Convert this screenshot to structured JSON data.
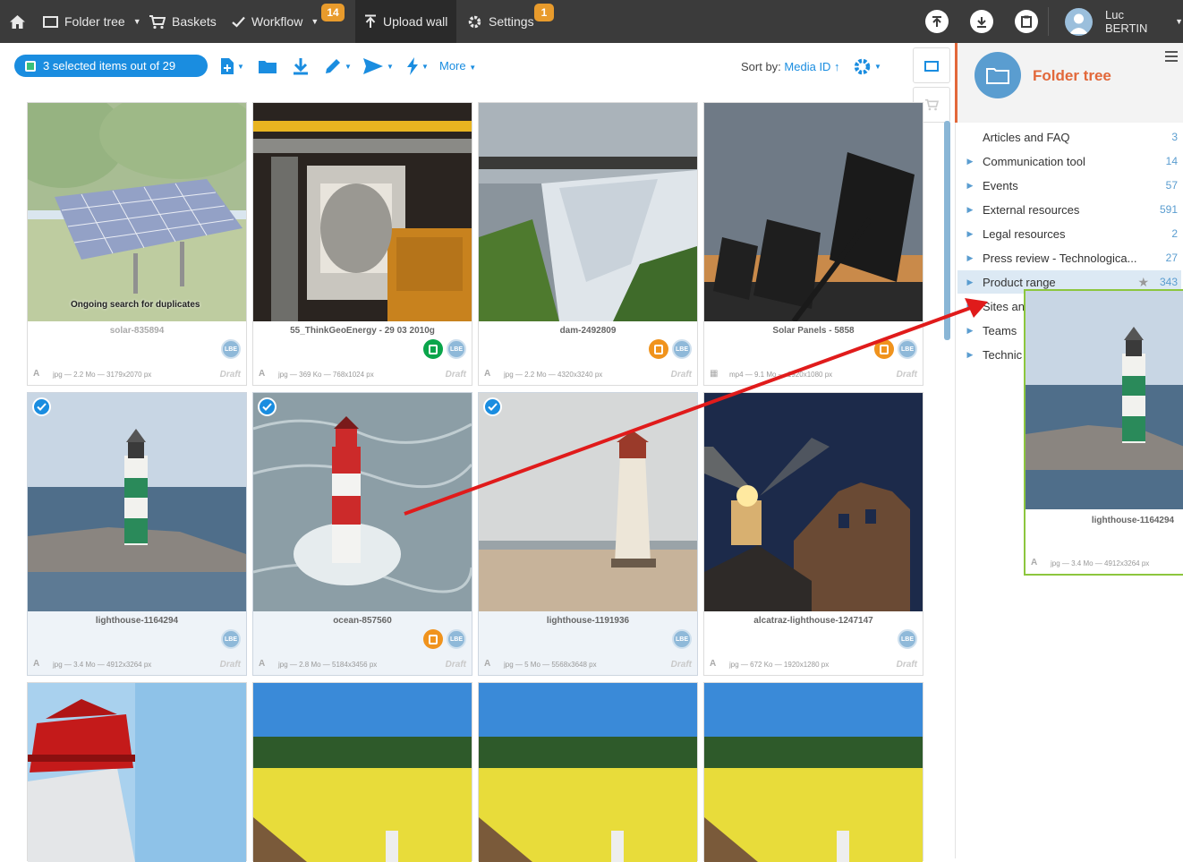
{
  "topnav": {
    "folder_tree": "Folder tree",
    "baskets": "Baskets",
    "workflow": "Workflow",
    "workflow_badge": "14",
    "upload_wall": "Upload wall",
    "settings": "Settings",
    "settings_badge": "1",
    "user_name": "Luc BERTIN"
  },
  "toolbar": {
    "selection_label": "3 selected items out of 29",
    "more_label": "More",
    "sort_prefix": "Sort by:",
    "sort_value": "Media ID ↑"
  },
  "cards": [
    {
      "caption": "solar-835894",
      "meta": "jpg — 2.2 Mo — 3179x2070 px",
      "status": "Draft",
      "overlay": "Ongoing search for duplicates",
      "badge": "LBE",
      "extra_badge": null,
      "selected": false,
      "type_icon": "A"
    },
    {
      "caption": "55_ThinkGeoEnergy - 29 03 2010g",
      "meta": "jpg — 369 Ko — 768x1024 px",
      "status": "Draft",
      "badge": "LBE",
      "extra_badge": "green",
      "selected": false,
      "type_icon": "A"
    },
    {
      "caption": "dam-2492809",
      "meta": "jpg — 2.2 Mo — 4320x3240 px",
      "status": "Draft",
      "badge": "LBE",
      "extra_badge": "orange",
      "selected": false,
      "type_icon": "A"
    },
    {
      "caption": "Solar Panels - 5858",
      "meta": "mp4 — 9.1 Mo — 1920x1080 px",
      "status": "Draft",
      "badge": "LBE",
      "extra_badge": "orange",
      "selected": false,
      "type_icon": "▦"
    },
    {
      "caption": "lighthouse-1164294",
      "meta": "jpg — 3.4 Mo — 4912x3264 px",
      "status": "Draft",
      "badge": "LBE",
      "extra_badge": null,
      "selected": true,
      "type_icon": "A"
    },
    {
      "caption": "ocean-857560",
      "meta": "jpg — 2.8 Mo — 5184x3456 px",
      "status": "Draft",
      "badge": "LBE",
      "extra_badge": "orange",
      "selected": true,
      "type_icon": "A"
    },
    {
      "caption": "lighthouse-1191936",
      "meta": "jpg — 5 Mo — 5568x3648 px",
      "status": "Draft",
      "badge": "LBE",
      "extra_badge": null,
      "selected": true,
      "type_icon": "A"
    },
    {
      "caption": "alcatraz-lighthouse-1247147",
      "meta": "jpg — 672 Ko — 1920x1280 px",
      "status": "Draft",
      "badge": "LBE",
      "extra_badge": null,
      "selected": false,
      "type_icon": "A"
    }
  ],
  "folder_panel": {
    "title": "Folder tree",
    "items": [
      {
        "label": "Articles and FAQ",
        "count": "3",
        "expandable": false
      },
      {
        "label": "Communication tool",
        "count": "14",
        "expandable": true
      },
      {
        "label": "Events",
        "count": "57",
        "expandable": true
      },
      {
        "label": "External resources",
        "count": "591",
        "expandable": true
      },
      {
        "label": "Legal resources",
        "count": "2",
        "expandable": true
      },
      {
        "label": "Press review - Technologica...",
        "count": "27",
        "expandable": true
      },
      {
        "label": "Product range",
        "count": "343",
        "expandable": true,
        "starred": true
      },
      {
        "label": "Sites an",
        "count": "",
        "expandable": true
      },
      {
        "label": "Teams",
        "count": "",
        "expandable": true
      },
      {
        "label": "Technic",
        "count": "",
        "expandable": true
      }
    ]
  },
  "drag_ghost": {
    "caption": "lighthouse-1164294",
    "meta": "jpg — 3.4 Mo — 4912x3264 px",
    "type_icon": "A"
  },
  "colors": {
    "topbar": "#3b3b3b",
    "accent": "#1a8de0",
    "badge": "#e89b2c",
    "panel_title": "#e2683a",
    "drag_border": "#8cc63e",
    "arrow": "#e01b1b"
  }
}
